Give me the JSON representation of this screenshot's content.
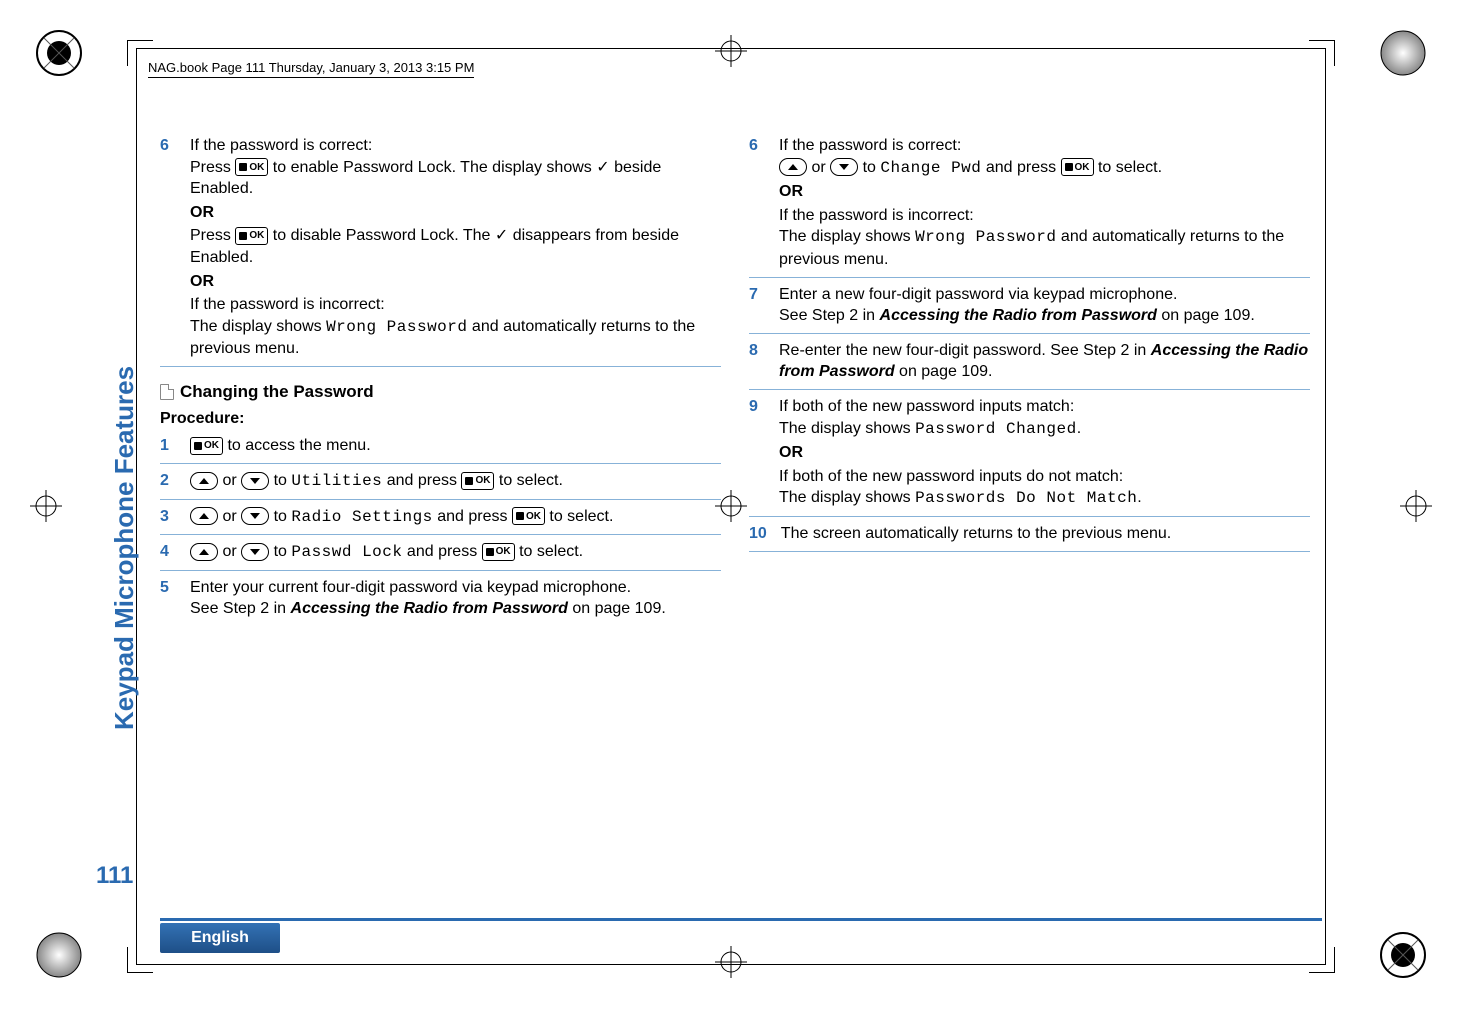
{
  "header": "NAG.book  Page 111  Thursday, January 3, 2013  3:15 PM",
  "sideLabel": "Keypad Microphone Features",
  "pageNumber": "111",
  "language": "English",
  "left": {
    "step6": {
      "num": "6",
      "line1a": "If the password is correct:",
      "line2a": "Press ",
      "line2b": " to enable Password Lock. The display shows ",
      "check": "✓",
      "line2c": " beside Enabled.",
      "or1": "OR",
      "line3a": "Press ",
      "line3b": " to disable Password Lock. The ",
      "line3c": " disappears from beside Enabled.",
      "or2": "OR",
      "line4": "If the password is incorrect:",
      "line5a": "The display shows ",
      "wrong": "Wrong Password",
      "line5b": " and automatically returns to the previous menu."
    },
    "sectionTitle": "Changing the Password",
    "procedure": "Procedure:",
    "s1": {
      "num": "1",
      "text": " to access the menu."
    },
    "s2": {
      "num": "2",
      "a": " or ",
      "b": " to ",
      "util": "Utilities",
      "c": " and press ",
      "d": " to select."
    },
    "s3": {
      "num": "3",
      "a": " or ",
      "b": " to ",
      "radio": "Radio Settings",
      "c": " and press ",
      "d": " to select."
    },
    "s4": {
      "num": "4",
      "a": " or ",
      "b": " to ",
      "pwd": "Passwd Lock",
      "c": " and press ",
      "d": " to select."
    },
    "s5": {
      "num": "5",
      "l1": "Enter your current four-digit password via keypad microphone.",
      "l2a": "See Step 2 in ",
      "ref": "Accessing the Radio from Password",
      "l2b": " on page 109."
    }
  },
  "right": {
    "s6": {
      "num": "6",
      "l1": "If the password is correct:",
      "a": " or ",
      "b": " to ",
      "chg": "Change Pwd",
      "c": " and press ",
      "d": " to select.",
      "or": "OR",
      "l3": "If the password is incorrect:",
      "l4a": "The display shows ",
      "wrong": "Wrong Password",
      "l4b": " and automatically returns to the previous menu."
    },
    "s7": {
      "num": "7",
      "l1": "Enter a new four-digit password via keypad microphone.",
      "l2a": "See Step 2 in ",
      "ref": "Accessing the Radio from Password",
      "l2b": " on page 109."
    },
    "s8": {
      "num": "8",
      "l1a": "Re-enter the new four-digit password. See Step 2 in ",
      "ref": "Accessing the Radio from Password",
      "l1b": " on page 109."
    },
    "s9": {
      "num": "9",
      "l1": "If both of the new password inputs match:",
      "l2a": "The display shows ",
      "pc": "Password Changed",
      "l2b": ".",
      "or": "OR",
      "l3": "If both of the new password inputs do not match:",
      "l4a": "The display shows ",
      "pnm": "Passwords Do Not Match",
      "l4b": "."
    },
    "s10": {
      "num": "10",
      "text": " The screen automatically returns to the previous menu."
    }
  },
  "okLabel": "OK"
}
